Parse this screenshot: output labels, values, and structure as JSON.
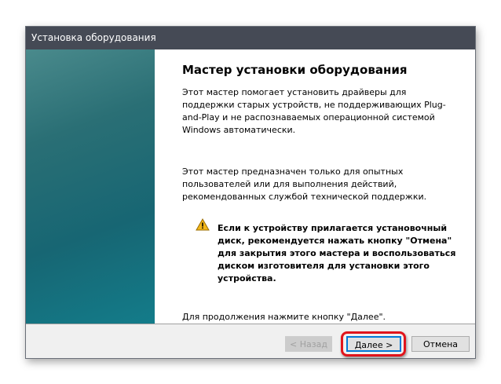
{
  "window": {
    "title": "Установка оборудования"
  },
  "main": {
    "heading": "Мастер установки оборудования",
    "paragraph1": "Этот мастер помогает установить драйверы для поддержки старых устройств, не поддерживающих Plug-and-Play и не распознаваемых операционной системой Windows автоматически.",
    "paragraph2": "Этот мастер предназначен только для опытных пользователей или для выполнения действий, рекомендованных службой технической поддержки.",
    "warning": "Если к устройству прилагается установочный диск, рекомендуется нажать кнопку \"Отмена\" для закрытия этого мастера и воспользоваться диском изготовителя для установки этого устройства.",
    "continue_hint": "Для продолжения нажмите кнопку \"Далее\"."
  },
  "buttons": {
    "back": "< Назад",
    "next": "Далее >",
    "cancel": "Отмена"
  },
  "colors": {
    "highlight": "#e0141c",
    "titlebar": "#454a55"
  }
}
